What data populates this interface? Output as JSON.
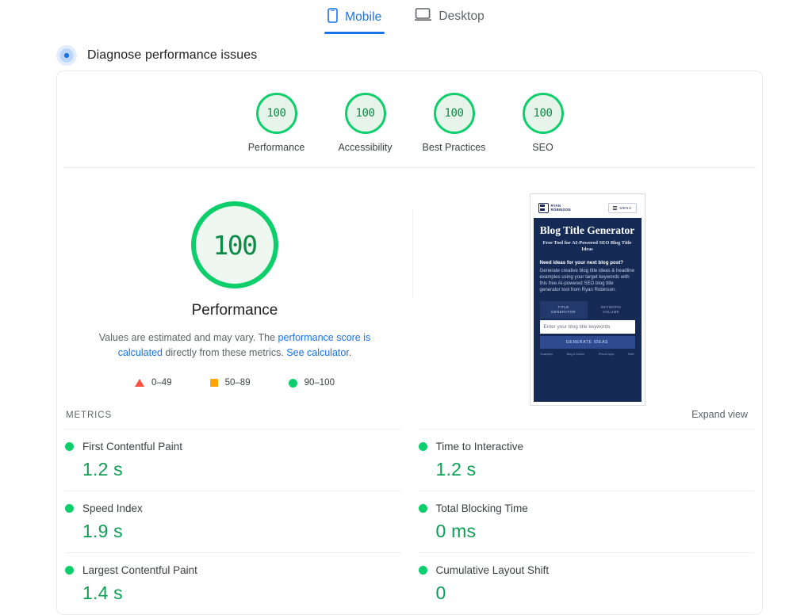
{
  "tabs": [
    {
      "label": "Mobile",
      "icon": "mobile-icon",
      "active": true
    },
    {
      "label": "Desktop",
      "icon": "desktop-icon",
      "active": false
    }
  ],
  "diagnose": {
    "title": "Diagnose performance issues",
    "icon": "pulse-dot-icon"
  },
  "category_scores": [
    {
      "score": "100",
      "label": "Performance"
    },
    {
      "score": "100",
      "label": "Accessibility"
    },
    {
      "score": "100",
      "label": "Best Practices"
    },
    {
      "score": "100",
      "label": "SEO"
    }
  ],
  "hero": {
    "score": "100",
    "metric_name": "Performance",
    "description_part1": "Values are estimated and may vary. The ",
    "description_link1": "performance score is calculated",
    "description_part2": " directly from these metrics. ",
    "description_link2": "See calculator",
    "description_part3": "."
  },
  "legend": [
    {
      "shape": "triangle",
      "range": "0–49",
      "color": "#ff4e42"
    },
    {
      "shape": "square",
      "range": "50–89",
      "color": "#ffa400"
    },
    {
      "shape": "circle",
      "range": "90–100",
      "color": "#0cce6b"
    }
  ],
  "thumbnail": {
    "logo_line1": "RYAN",
    "logo_line2": "ROBINSON",
    "menu_label": "MENU",
    "title": "Blog Title Generator",
    "subtitle": "Free Tool for AI-Powered SEO Blog Title Ideas",
    "question": "Need ideas for your next blog post?",
    "body": "Generate creative blog title ideas & headline examples using your target keywords with this free AI-powered SEO blog title generator tool from Ryan Robinson.",
    "tab1_line1": "TITLE",
    "tab1_line2": "GENERATOR",
    "tab2_line1": "KEYWORD",
    "tab2_line2": "VOLUME",
    "input_placeholder": "Enter your blog title keywords",
    "button_label": "GENERATE IDEAS",
    "footer": [
      "Examples",
      "Blog & Culture",
      "iPhone Apps",
      "Brief"
    ]
  },
  "metrics": {
    "section_title": "METRICS",
    "expand_label": "Expand view",
    "left_column": [
      {
        "name": "First Contentful Paint",
        "value": "1.2 s",
        "status": "good"
      },
      {
        "name": "Speed Index",
        "value": "1.9 s",
        "status": "good"
      },
      {
        "name": "Largest Contentful Paint",
        "value": "1.4 s",
        "status": "good"
      }
    ],
    "right_column": [
      {
        "name": "Time to Interactive",
        "value": "1.2 s",
        "status": "good"
      },
      {
        "name": "Total Blocking Time",
        "value": "0 ms",
        "status": "good"
      },
      {
        "name": "Cumulative Layout Shift",
        "value": "0",
        "status": "good"
      }
    ]
  },
  "colors": {
    "good": "#0cce6b",
    "average": "#ffa400",
    "poor": "#ff4e42",
    "link": "#1a73e8",
    "value_text": "#0b9f54"
  }
}
